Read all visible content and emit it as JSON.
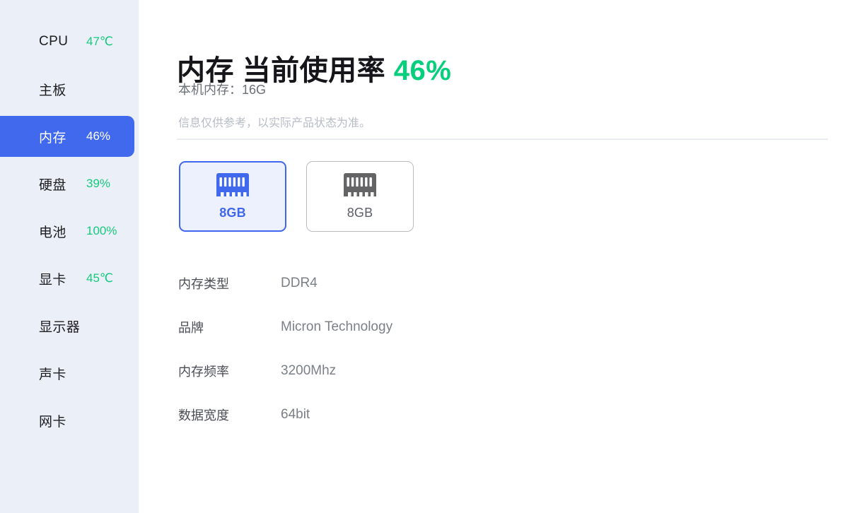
{
  "sidebar": {
    "items": [
      {
        "label": "CPU",
        "value": "47℃",
        "selected": false
      },
      {
        "label": "主板",
        "value": "",
        "selected": false
      },
      {
        "label": "内存",
        "value": "46%",
        "selected": true
      },
      {
        "label": "硬盘",
        "value": "39%",
        "selected": false
      },
      {
        "label": "电池",
        "value": "100%",
        "selected": false
      },
      {
        "label": "显卡",
        "value": "45℃",
        "selected": false
      },
      {
        "label": "显示器",
        "value": "",
        "selected": false
      },
      {
        "label": "声卡",
        "value": "",
        "selected": false
      },
      {
        "label": "网卡",
        "value": "",
        "selected": false
      }
    ]
  },
  "main": {
    "title_text": "内存 当前使用率 ",
    "title_percent": "46%",
    "subtitle": "本机内存：16G",
    "note": "信息仅供参考，以实际产品状态为准。",
    "slots": [
      {
        "capacity": "8GB",
        "selected": true,
        "icon": "ram-stick-icon"
      },
      {
        "capacity": "8GB",
        "selected": false,
        "icon": "ram-stick-icon"
      }
    ],
    "details": [
      {
        "key": "内存类型",
        "value": "DDR4"
      },
      {
        "key": "品牌",
        "value": "Micron Technology"
      },
      {
        "key": "内存频率",
        "value": "3200Mhz"
      },
      {
        "key": "数据宽度",
        "value": "64bit"
      }
    ]
  },
  "colors": {
    "sidebar_bg": "#ebeff8",
    "accent_blue": "#4069ee",
    "status_green": "#17c97c",
    "title_green": "#05ce7c",
    "slot_icon_selected": "#4069ee",
    "slot_icon_idle": "#646466"
  }
}
